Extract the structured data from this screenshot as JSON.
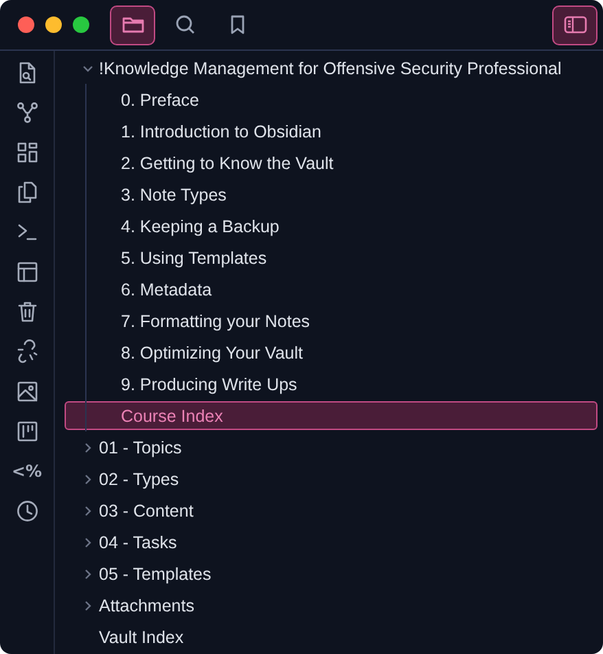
{
  "toolbar": {
    "tabs": [
      {
        "kind": "folder",
        "selected": true
      },
      {
        "kind": "search",
        "selected": false
      },
      {
        "kind": "bookmark",
        "selected": false
      }
    ],
    "sidebar_toggle": {
      "on": true
    }
  },
  "ribbon": [
    {
      "kind": "switcher"
    },
    {
      "kind": "graph"
    },
    {
      "kind": "canvas"
    },
    {
      "kind": "copy"
    },
    {
      "kind": "terminal"
    },
    {
      "kind": "layout"
    },
    {
      "kind": "trash"
    },
    {
      "kind": "unlink"
    },
    {
      "kind": "image"
    },
    {
      "kind": "kanban"
    },
    {
      "kind": "text",
      "label": "<%"
    },
    {
      "kind": "clock"
    }
  ],
  "tree": [
    {
      "kind": "folder",
      "name": "!Knowledge Management for Offensive Security Professional",
      "expanded": true,
      "children": [
        {
          "kind": "file",
          "name": "0. Preface",
          "selected": false
        },
        {
          "kind": "file",
          "name": "1. Introduction to Obsidian",
          "selected": false
        },
        {
          "kind": "file",
          "name": "2. Getting to Know the Vault",
          "selected": false
        },
        {
          "kind": "file",
          "name": "3. Note Types",
          "selected": false
        },
        {
          "kind": "file",
          "name": "4. Keeping a Backup",
          "selected": false
        },
        {
          "kind": "file",
          "name": "5. Using Templates",
          "selected": false
        },
        {
          "kind": "file",
          "name": "6. Metadata",
          "selected": false
        },
        {
          "kind": "file",
          "name": "7. Formatting your Notes",
          "selected": false
        },
        {
          "kind": "file",
          "name": "8. Optimizing Your Vault",
          "selected": false
        },
        {
          "kind": "file",
          "name": "9. Producing Write Ups",
          "selected": false
        },
        {
          "kind": "file",
          "name": "Course Index",
          "selected": true
        }
      ]
    },
    {
      "kind": "folder",
      "name": "01 - Topics",
      "expanded": false
    },
    {
      "kind": "folder",
      "name": "02 - Types",
      "expanded": false
    },
    {
      "kind": "folder",
      "name": "03 - Content",
      "expanded": false
    },
    {
      "kind": "folder",
      "name": "04 - Tasks",
      "expanded": false
    },
    {
      "kind": "folder",
      "name": "05 - Templates",
      "expanded": false
    },
    {
      "kind": "folder",
      "name": "Attachments",
      "expanded": false
    },
    {
      "kind": "file",
      "name": "Vault Index",
      "selected": false
    }
  ]
}
